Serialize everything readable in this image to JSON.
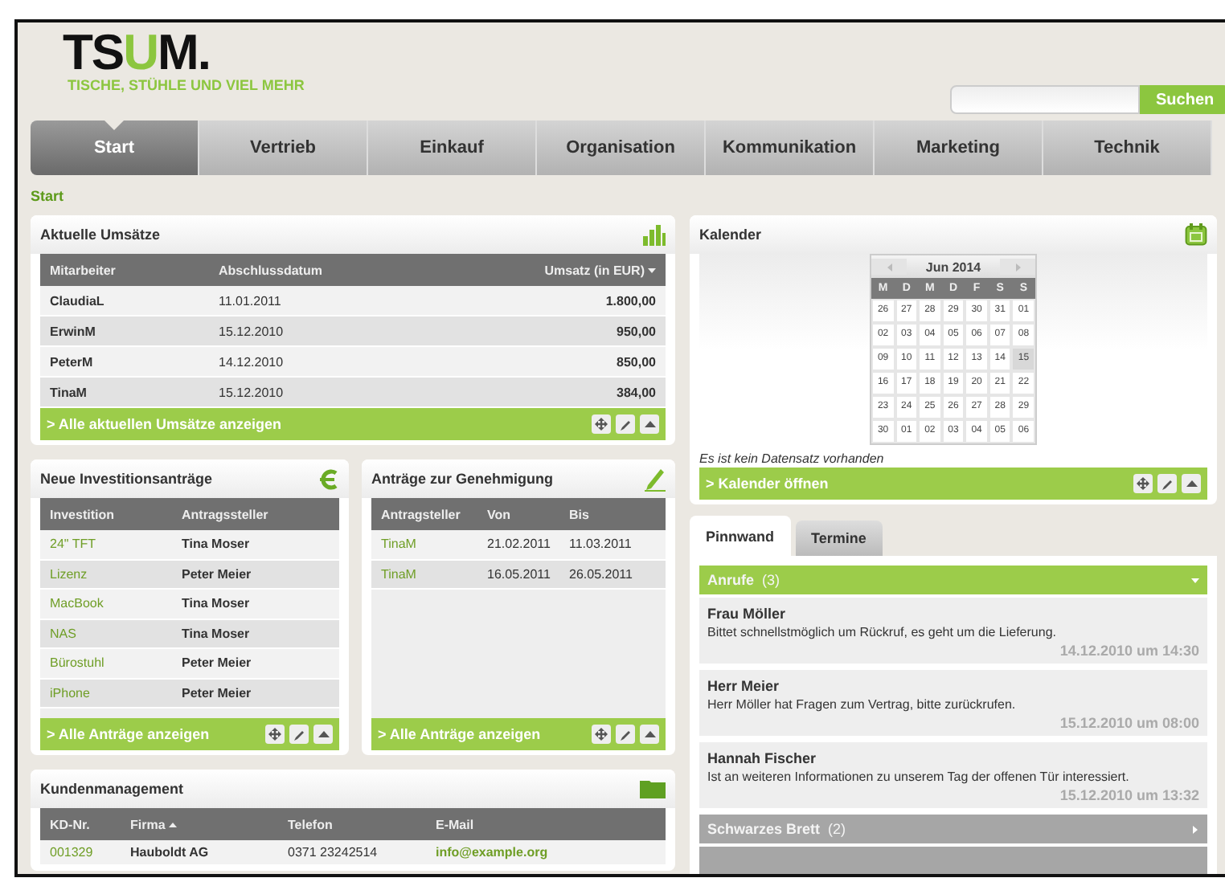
{
  "logo": {
    "brand_parts": [
      {
        "text": "TS",
        "color": "#111111"
      },
      {
        "text": "U",
        "color": "#8cc63f"
      },
      {
        "text": "M.",
        "color": "#111111"
      }
    ],
    "tagline": "TISCHE, STÜHLE UND VIEL MEHR"
  },
  "search": {
    "button": "Suchen"
  },
  "nav": [
    {
      "label": "Start",
      "selected": true
    },
    {
      "label": "Vertrieb",
      "selected": false
    },
    {
      "label": "Einkauf",
      "selected": false
    },
    {
      "label": "Organisation",
      "selected": false
    },
    {
      "label": "Kommunikation",
      "selected": false
    },
    {
      "label": "Marketing",
      "selected": false
    },
    {
      "label": "Technik",
      "selected": false
    }
  ],
  "breadcrumb": "Start",
  "sales": {
    "title": "Aktuelle Umsätze",
    "columns": [
      "Mitarbeiter",
      "Abschlussdatum",
      "Umsatz (in EUR)"
    ],
    "rows": [
      [
        "ClaudiaL",
        "11.01.2011",
        "1.800,00"
      ],
      [
        "ErwinM",
        "15.12.2010",
        "950,00"
      ],
      [
        "PeterM",
        "14.12.2010",
        "850,00"
      ],
      [
        "TinaM",
        "15.12.2010",
        "384,00"
      ]
    ],
    "footer_link": "> Alle aktuellen Umsätze anzeigen"
  },
  "investments": {
    "title": "Neue Investitionsanträge",
    "columns": [
      "Investition",
      "Antragssteller"
    ],
    "rows": [
      [
        "24\" TFT",
        "Tina Moser"
      ],
      [
        "Lizenz",
        "Peter Meier"
      ],
      [
        "MacBook",
        "Tina Moser"
      ],
      [
        "NAS",
        "Tina Moser"
      ],
      [
        "Bürostuhl",
        "Peter Meier"
      ],
      [
        "iPhone",
        "Peter Meier"
      ]
    ],
    "footer_link": "> Alle Anträge anzeigen"
  },
  "approvals": {
    "title": "Anträge zur Genehmigung",
    "columns": [
      "Antragsteller",
      "Von",
      "Bis"
    ],
    "rows": [
      [
        "TinaM",
        "21.02.2011",
        "11.03.2011"
      ],
      [
        "TinaM",
        "16.05.2011",
        "26.05.2011"
      ]
    ],
    "footer_link": "> Alle Anträge anzeigen"
  },
  "customers": {
    "title": "Kundenmanagement",
    "columns": [
      "KD-Nr.",
      "Firma",
      "Telefon",
      "E-Mail"
    ],
    "rows": [
      [
        "001329",
        "Hauboldt AG",
        "0371 23242514",
        "info@example.org"
      ]
    ]
  },
  "calendar": {
    "title": "Kalender",
    "month": "Jun 2014",
    "weekdays": [
      "M",
      "D",
      "M",
      "D",
      "F",
      "S",
      "S"
    ],
    "weeks": [
      [
        {
          "d": "26",
          "selected": false
        },
        {
          "d": "27",
          "selected": false
        },
        {
          "d": "28",
          "selected": false
        },
        {
          "d": "29",
          "selected": false
        },
        {
          "d": "30",
          "selected": false
        },
        {
          "d": "31",
          "selected": false
        },
        {
          "d": "01",
          "selected": false
        }
      ],
      [
        {
          "d": "02",
          "selected": false
        },
        {
          "d": "03",
          "selected": false
        },
        {
          "d": "04",
          "selected": false
        },
        {
          "d": "05",
          "selected": false
        },
        {
          "d": "06",
          "selected": false
        },
        {
          "d": "07",
          "selected": false
        },
        {
          "d": "08",
          "selected": false
        }
      ],
      [
        {
          "d": "09",
          "selected": false
        },
        {
          "d": "10",
          "selected": false
        },
        {
          "d": "11",
          "selected": false
        },
        {
          "d": "12",
          "selected": false
        },
        {
          "d": "13",
          "selected": false
        },
        {
          "d": "14",
          "selected": false
        },
        {
          "d": "15",
          "selected": true
        }
      ],
      [
        {
          "d": "16",
          "selected": false
        },
        {
          "d": "17",
          "selected": false
        },
        {
          "d": "18",
          "selected": false
        },
        {
          "d": "19",
          "selected": false
        },
        {
          "d": "20",
          "selected": false
        },
        {
          "d": "21",
          "selected": false
        },
        {
          "d": "22",
          "selected": false
        }
      ],
      [
        {
          "d": "23",
          "selected": false
        },
        {
          "d": "24",
          "selected": false
        },
        {
          "d": "25",
          "selected": false
        },
        {
          "d": "26",
          "selected": false
        },
        {
          "d": "27",
          "selected": false
        },
        {
          "d": "28",
          "selected": false
        },
        {
          "d": "29",
          "selected": false
        }
      ],
      [
        {
          "d": "30",
          "selected": false
        },
        {
          "d": "01",
          "selected": false
        },
        {
          "d": "02",
          "selected": false
        },
        {
          "d": "03",
          "selected": false
        },
        {
          "d": "04",
          "selected": false
        },
        {
          "d": "05",
          "selected": false
        },
        {
          "d": "06",
          "selected": false
        }
      ]
    ],
    "empty_note": "Es ist kein Datensatz vorhanden",
    "footer_link": "> Kalender öffnen"
  },
  "board": {
    "tabs": [
      {
        "label": "Pinnwand",
        "selected": true
      },
      {
        "label": "Termine",
        "selected": false
      }
    ],
    "sections": [
      {
        "title": "Anrufe",
        "count": "(3)",
        "expanded": true,
        "items": [
          {
            "name": "Frau Möller",
            "text": "Bittet schnellstmöglich um Rückruf, es geht um die Lieferung.",
            "time": "14.12.2010 um 14:30"
          },
          {
            "name": "Herr Meier",
            "text": "Herr Möller hat Fragen zum Vertrag, bitte zurückrufen.",
            "time": "15.12.2010 um 08:00"
          },
          {
            "name": "Hannah Fischer",
            "text": "Ist an weiteren Informationen zu unserem Tag der offenen Tür interessiert.",
            "time": "15.12.2010 um 13:32"
          }
        ]
      },
      {
        "title": "Schwarzes Brett",
        "count": "(2)",
        "expanded": false
      }
    ]
  }
}
